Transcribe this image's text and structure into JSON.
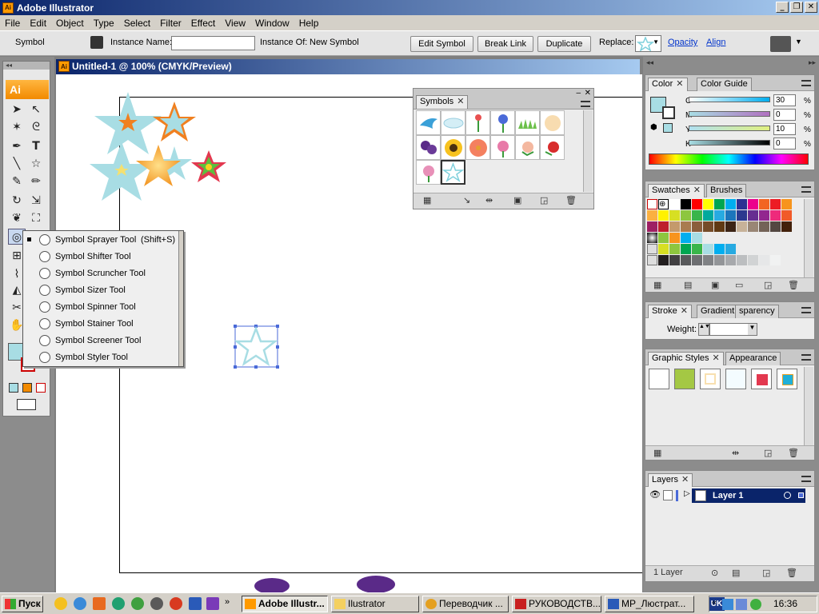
{
  "window": {
    "title": "Adobe Illustrator",
    "app_badge": "Ai",
    "min": "_",
    "restore": "❐",
    "close": "✕"
  },
  "menu": [
    "File",
    "Edit",
    "Object",
    "Type",
    "Select",
    "Filter",
    "Effect",
    "View",
    "Window",
    "Help"
  ],
  "control_bar": {
    "selection_label": "Symbol",
    "instance_name_label": "Instance Name:",
    "instance_name_value": "",
    "instance_of_label": "Instance Of:",
    "instance_of_value": "New Symbol",
    "edit_symbol": "Edit Symbol",
    "break_link": "Break Link",
    "duplicate": "Duplicate",
    "replace_label": "Replace:",
    "opacity_link": "Opacity",
    "align_link": "Align"
  },
  "toolbox": {
    "logo": "Ai"
  },
  "document": {
    "tab_title": "Untitled-1 @ 100% (CMYK/Preview)"
  },
  "flyout": {
    "items": [
      {
        "label": "Symbol Sprayer Tool",
        "shortcut": "(Shift+S)"
      },
      {
        "label": "Symbol Shifter Tool",
        "shortcut": ""
      },
      {
        "label": "Symbol Scruncher Tool",
        "shortcut": ""
      },
      {
        "label": "Symbol Sizer Tool",
        "shortcut": ""
      },
      {
        "label": "Symbol Spinner Tool",
        "shortcut": ""
      },
      {
        "label": "Symbol Stainer Tool",
        "shortcut": ""
      },
      {
        "label": "Symbol Screener Tool",
        "shortcut": ""
      },
      {
        "label": "Symbol Styler Tool",
        "shortcut": ""
      }
    ]
  },
  "symbols_panel": {
    "tab": "Symbols"
  },
  "color_panel": {
    "tabs": [
      "Color",
      "Color Guide"
    ],
    "channels": [
      {
        "name": "C",
        "value": "30",
        "unit": "%"
      },
      {
        "name": "M",
        "value": "0",
        "unit": "%"
      },
      {
        "name": "Y",
        "value": "10",
        "unit": "%"
      },
      {
        "name": "K",
        "value": "0",
        "unit": "%"
      }
    ],
    "fill_color": "#a8dde4"
  },
  "swatches_panel": {
    "tabs": [
      "Swatches",
      "Brushes"
    ]
  },
  "stroke_panel": {
    "tabs": [
      "Stroke",
      "Gradient",
      "sparency"
    ],
    "weight_label": "Weight:"
  },
  "styles_panel": {
    "tabs": [
      "Graphic Styles",
      "Appearance"
    ]
  },
  "layers_panel": {
    "tab": "Layers",
    "layer_name": "Layer 1",
    "count": "1 Layer"
  },
  "taskbar": {
    "start": "Пуск",
    "tasks": [
      "Adobe Illustr...",
      "Ilustrator",
      "Переводчик ...",
      "РУКОВОДСТВ...",
      "МР_Люстрат..."
    ],
    "lang": "UK",
    "clock": "16:36"
  }
}
